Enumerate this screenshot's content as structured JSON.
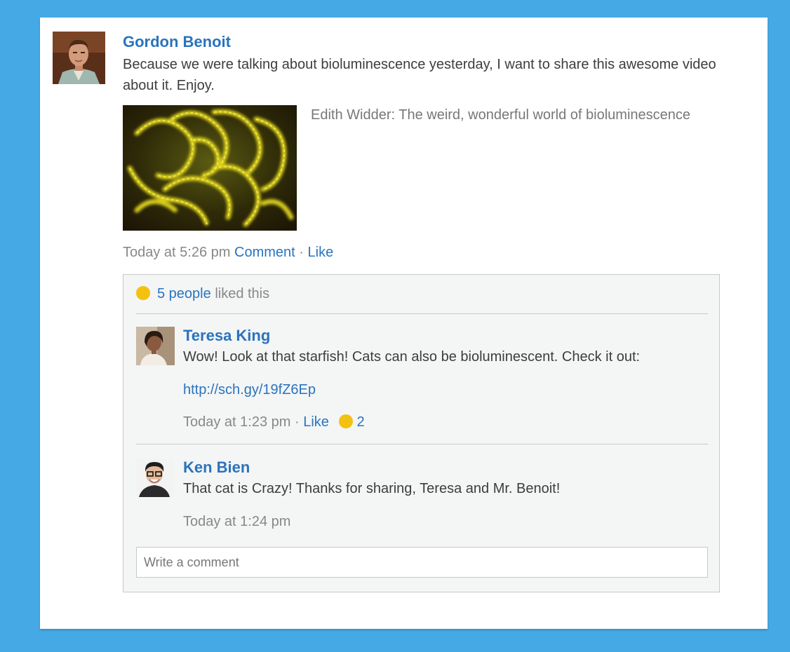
{
  "post": {
    "author": "Gordon Benoit",
    "text": "Because we were talking about bioluminescence yesterday, I want to share this awesome video about it. Enjoy.",
    "attachment_title": "Edith Widder: The weird, wonderful world of bioluminescence",
    "timestamp": "Today at 5:26 pm",
    "comment_label": "Comment",
    "separator": "·",
    "like_label": "Like"
  },
  "likes": {
    "count_label": "5 people",
    "suffix": "liked this"
  },
  "comments": [
    {
      "author": "Teresa King",
      "text": "Wow! Look at that starfish! Cats can also be bioluminescent. Check it out:",
      "link": "http://sch.gy/19fZ6Ep",
      "timestamp": "Today at 1:23 pm",
      "separator": "·",
      "like_label": "Like",
      "like_count": "2"
    },
    {
      "author": "Ken Bien",
      "text": "That cat is Crazy! Thanks for sharing, Teresa and Mr. Benoit!",
      "timestamp": "Today at 1:24 pm"
    }
  ],
  "comment_input": {
    "placeholder": "Write a comment"
  },
  "colors": {
    "background": "#45a9e6",
    "link": "#2a74bd",
    "like_dot": "#f3c10f",
    "muted_text": "#888888",
    "body_text": "#3d3d3d"
  }
}
